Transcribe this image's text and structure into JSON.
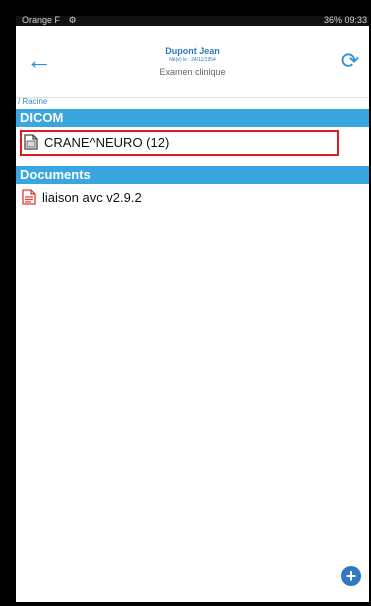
{
  "status": {
    "carrier": "Orange F",
    "right": "36%  09:33"
  },
  "header": {
    "name": "Dupont Jean",
    "dob": "Né(e) le : 24/11/1954",
    "exam": "Examen clinique"
  },
  "breadcrumb": "/ Racine",
  "sections": [
    {
      "title": "DICOM",
      "items": [
        {
          "label": "CRANE^NEURO (12)"
        }
      ]
    },
    {
      "title": "Documents",
      "items": [
        {
          "label": "liaison avc v2.9.2"
        }
      ]
    }
  ],
  "colors": {
    "accent": "#2f8ed6",
    "section": "#3aa6e0",
    "selection": "#e21b23"
  },
  "icons": {
    "back": "arrow-left-icon",
    "refresh": "refresh-icon",
    "dicom": "dicom-file-icon",
    "pdf": "pdf-file-icon",
    "add": "add-icon"
  }
}
